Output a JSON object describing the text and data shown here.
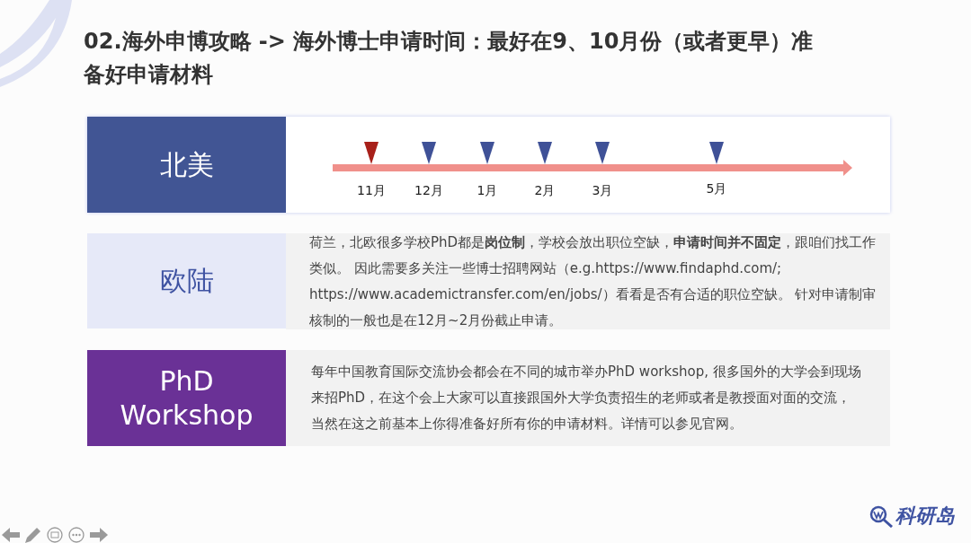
{
  "title": "02.海外申博攻略 -> 海外博士申请时间：最好在9、10月份（或者更早）准备好申请材料",
  "regions": [
    {
      "kind": "timeline",
      "label": "北美",
      "months": [
        {
          "label": "11月",
          "color": "#a8201a"
        },
        {
          "label": "12月",
          "color": "#3f5197"
        },
        {
          "label": "1月",
          "color": "#3f5197"
        },
        {
          "label": "2月",
          "color": "#3f5197"
        },
        {
          "label": "3月",
          "color": "#3f5197"
        },
        {
          "label": "5月",
          "color": "#3f5197"
        }
      ]
    },
    {
      "kind": "text",
      "label": "欧陆",
      "text": "荷兰，北欧很多学校PhD都是**岗位制**，学校会放出职位空缺，**申请时间并不固定**，跟咱们找工作类似。 因此需要多关注一些博士招聘网站（e.g.https://www.findaphd.com/; https://www.academictransfer.com/en/jobs/）看看是否有合适的职位空缺。 针对申请制审核制的一般也是在12月~2月份截止申请。"
    },
    {
      "kind": "text-dark",
      "label": "PhD Workshop",
      "text": "每年中国教育国际交流协会都会在不同的城市举办PhD workshop, 很多国外的大学会到现场来招PhD，在这个会上大家可以直接跟国外大学负责招生的老师或者是教授面对面的交流，当然在这之前基本上你得准备好所有你的申请材料。详情可以参见官网。"
    }
  ],
  "logo": "科研岛"
}
